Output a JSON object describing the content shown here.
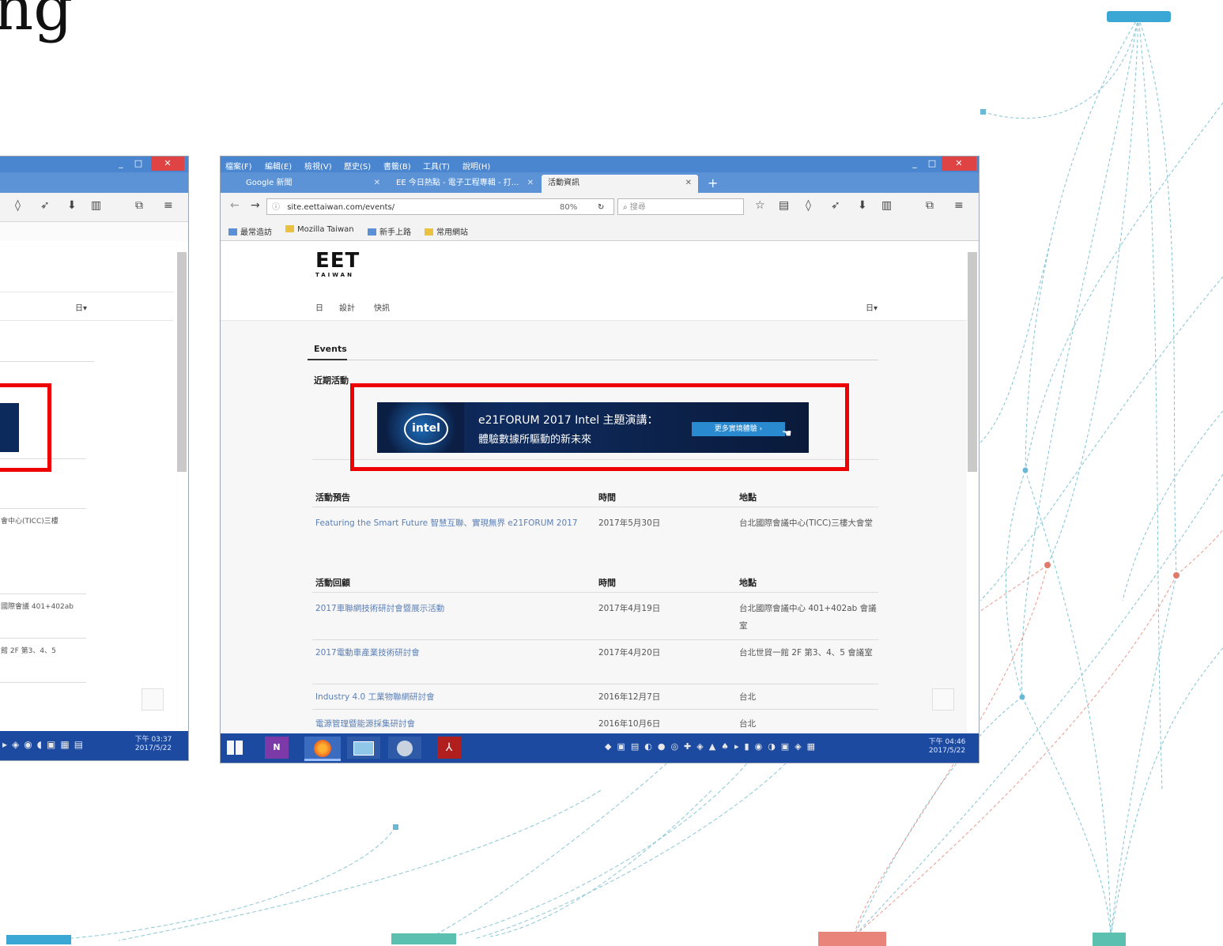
{
  "slide": {
    "title_fragment": "ng"
  },
  "left_window": {
    "dropdown": "日▾",
    "row1_place": "會中心(TICC)三樓",
    "row2_place": "國際會議 401+402ab",
    "row3_place": "館 2F 第3、4、5",
    "clock_time": "下午 03:37",
    "clock_date": "2017/5/22"
  },
  "main_window": {
    "menu": [
      "檔案(F)",
      "編輯(E)",
      "檢視(V)",
      "歷史(S)",
      "書籤(B)",
      "工具(T)",
      "說明(H)"
    ],
    "tabs": [
      {
        "label": "Google 新聞"
      },
      {
        "label": "EE 今日熱點 - 電子工程專輯 - 打..."
      },
      {
        "label": "活動資訊"
      }
    ],
    "url": "site.eettaiwan.com/events/",
    "zoom": "80%",
    "search_placeholder": "搜尋",
    "bookmarks": [
      "最常造訪",
      "Mozilla Taiwan",
      "新手上路",
      "常用網站"
    ],
    "logo": "EET",
    "logo_sub": "TAIWAN",
    "nav": [
      "日",
      "設計",
      "快訊"
    ],
    "dropdown": "日▾",
    "events_heading": "Events",
    "recent_label": "近期活動",
    "banner": {
      "brand": "intel",
      "line1": "e21FORUM 2017 Intel 主題演講：",
      "line2": "體驗數據所驅動的新未來",
      "button": "更多實境體驗 ›"
    },
    "upcoming_headers": [
      "活動預告",
      "時間",
      "地點"
    ],
    "upcoming_rows": [
      {
        "title": "Featuring the Smart Future 智慧互聯、實現無界 e21FORUM 2017",
        "date": "2017年5月30日",
        "place": "台北國際會議中心(TICC)三樓大會堂"
      }
    ],
    "past_headers": [
      "活動回顧",
      "時間",
      "地點"
    ],
    "past_rows": [
      {
        "title": "2017車聯網技術研討會暨展示活動",
        "date": "2017年4月19日",
        "place": "台北國際會議中心 401+402ab 會議室"
      },
      {
        "title": "2017電動車產業技術研討會",
        "date": "2017年4月20日",
        "place": "台北世貿一館 2F 第3、4、5 會議室"
      },
      {
        "title": "Industry 4.0 工業物聯網研討會",
        "date": "2016年12月7日",
        "place": "台北"
      },
      {
        "title": "電源管理暨能源採集研討會",
        "date": "2016年10月6日",
        "place": "台北"
      }
    ],
    "clock_time": "下午 04:46",
    "clock_date": "2017/5/22"
  }
}
